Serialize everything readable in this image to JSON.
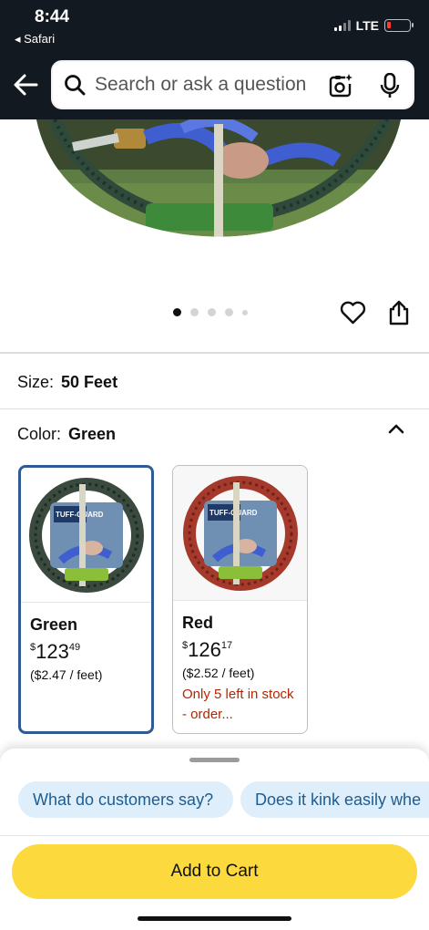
{
  "status_bar": {
    "time": "8:44",
    "back_app": "◂ Safari",
    "network": "LTE"
  },
  "header": {
    "search_placeholder": "Search or ask a question",
    "icons": [
      "back-arrow-icon",
      "search-icon",
      "camera-lens-icon",
      "microphone-icon"
    ]
  },
  "gallery": {
    "image_count": 5,
    "active_index": 0,
    "icons": [
      "heart-icon",
      "share-icon"
    ]
  },
  "size": {
    "label": "Size:",
    "value": "50 Feet"
  },
  "color": {
    "label": "Color:",
    "value": "Green"
  },
  "variants": [
    {
      "name": "Green",
      "currency": "$",
      "price_whole": "123",
      "price_fraction": "49",
      "unit_price": "($2.47 / feet)",
      "stock_note": "",
      "selected": true,
      "hose_color": "#3a4a3e"
    },
    {
      "name": "Red",
      "currency": "$",
      "price_whole": "126",
      "price_fraction": "17",
      "unit_price": "($2.52 / feet)",
      "stock_note": "Only 5 left in stock - order...",
      "selected": false,
      "hose_color": "#a5392c"
    }
  ],
  "bottom_sheet": {
    "chips": [
      "What do customers say?",
      "Does it kink easily whe"
    ],
    "add_to_cart": "Add to Cart"
  },
  "colors": {
    "header_bg": "#131921",
    "selected_border": "#2f5a94",
    "chip_bg": "#dfeefb",
    "chip_text": "#1d5d92",
    "cart_button": "#fcd93d",
    "stock_warning": "#b12704"
  }
}
